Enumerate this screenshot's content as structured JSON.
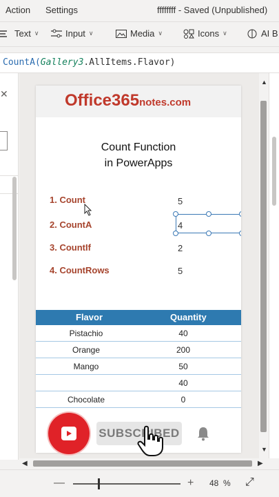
{
  "menubar": {
    "action_label": "Action",
    "settings_label": "Settings",
    "status_text": "ffffffff - Saved (Unpublished)"
  },
  "ribbon": {
    "text_label": "Text",
    "input_label": "Input",
    "media_label": "Media",
    "icons_label": "Icons",
    "ai_label": "AI B"
  },
  "formula": {
    "fn": "CountA(",
    "ref": "Gallery3",
    "rest": ".AllItems.Flavor)"
  },
  "app": {
    "logo_main": "Office365",
    "logo_suffix": "notes.com",
    "title_line1": "Count Function",
    "title_line2": "in PowerApps",
    "functions": [
      {
        "label": "1. Count",
        "value": "5"
      },
      {
        "label": "2. CountA",
        "value": "4"
      },
      {
        "label": "3. CountIf",
        "value": "2"
      },
      {
        "label": "4. CountRows",
        "value": "5"
      }
    ],
    "table": {
      "headers": [
        "Flavor",
        "Quantity"
      ],
      "rows": [
        [
          "Pistachio",
          "40"
        ],
        [
          "Orange",
          "200"
        ],
        [
          "Mango",
          "50"
        ],
        [
          "",
          "40"
        ],
        [
          "Chocolate",
          "0"
        ]
      ]
    }
  },
  "overlay": {
    "subscribe_label": "SUBSCRIBED"
  },
  "statusbar": {
    "zoom_value": "48",
    "zoom_unit": "%"
  },
  "colors": {
    "accent_blue": "#2e7ab0",
    "label_brown": "#a6442d",
    "logo_red": "#c0392b",
    "youtube_red": "#e02228"
  }
}
